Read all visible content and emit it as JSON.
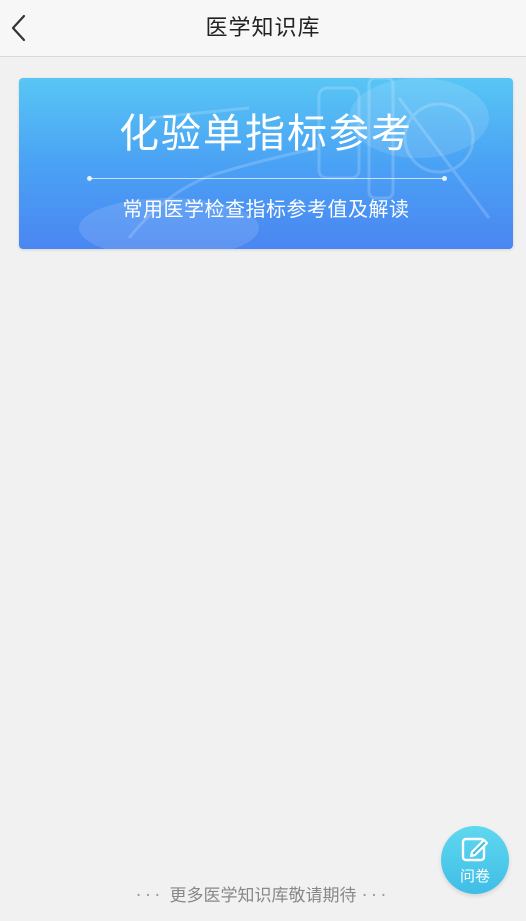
{
  "header": {
    "title": "医学知识库",
    "back_icon": "chevron-left-icon"
  },
  "banner": {
    "title": "化验单指标参考",
    "subtitle": "常用医学检查指标参考值及解读",
    "gradient_top": "#58c6f5",
    "gradient_bottom": "#4a86f2"
  },
  "footer": {
    "dots_left": "···",
    "text": "更多医学知识库敬请期待",
    "dots_right": "···"
  },
  "fab": {
    "label": "问卷",
    "icon": "edit-icon",
    "color": "#3fbde6"
  }
}
